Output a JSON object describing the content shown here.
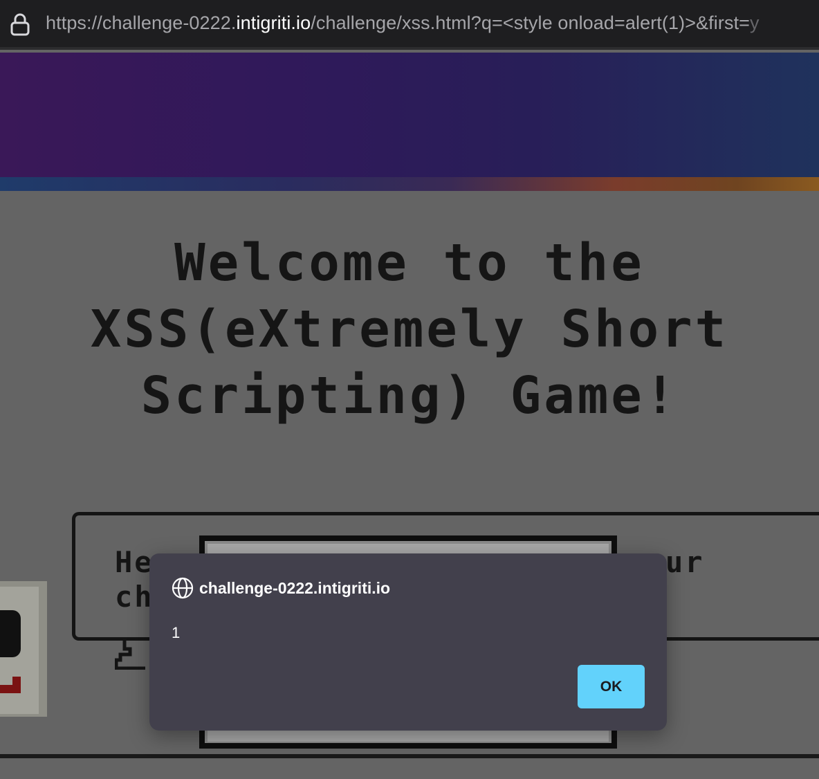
{
  "browser": {
    "url_prefix": "https://challenge-0222.",
    "url_host": "intigriti.io",
    "url_path": "/challenge/xss.html?q=<style onload=alert(1)>&first=",
    "url_tail": "y",
    "lock_icon": "lock-icon"
  },
  "page": {
    "title_line1": "Welcome to the",
    "title_line2": "XSS(eXtremely Short",
    "title_line3": "Scripting) Game!",
    "bubble_left_line1": "He",
    "bubble_left_line2": "ch",
    "bubble_right_line1": "ur"
  },
  "dialog": {
    "origin": "challenge-0222.intigriti.io",
    "message": "1",
    "ok_label": "OK",
    "icon": "globe-icon"
  },
  "colors": {
    "dialog_bg": "#42404c",
    "ok_button": "#62d2fb",
    "page_bg": "#646464"
  }
}
